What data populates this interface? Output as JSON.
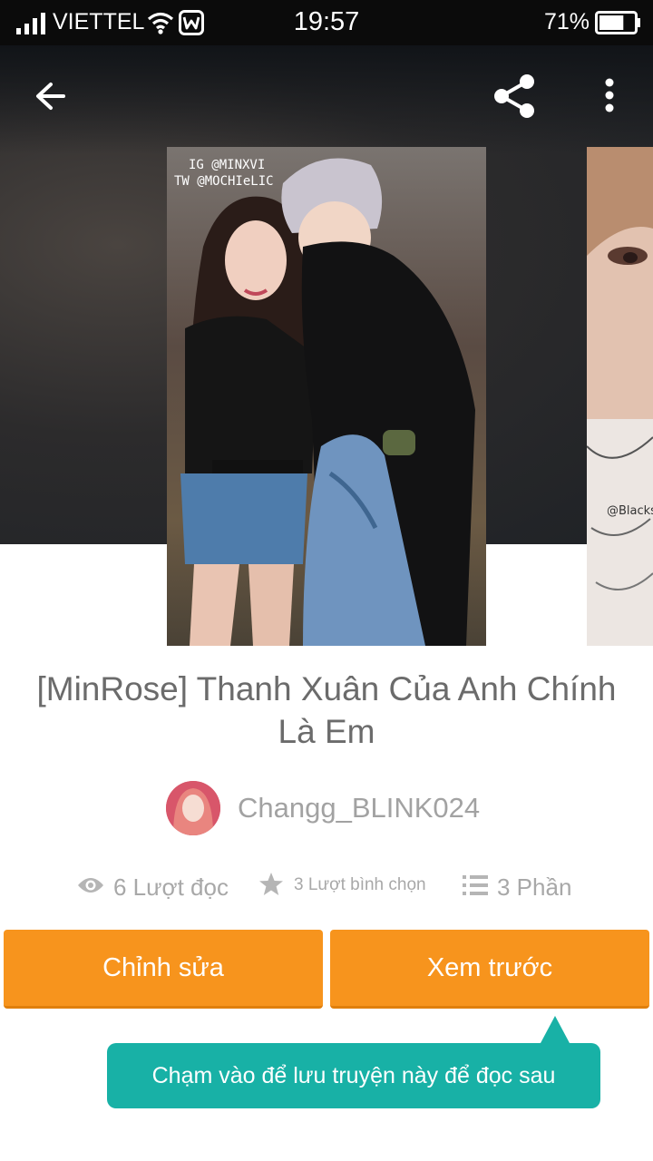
{
  "status_bar": {
    "carrier": "VIETTEL",
    "time": "19:57",
    "battery_percent": "71%",
    "battery_level": 0.71,
    "icons": [
      "signal-icon",
      "wifi-icon",
      "notification-w-icon",
      "battery-icon"
    ]
  },
  "toolbar": {
    "icons": [
      "back-arrow-icon",
      "share-icon",
      "more-vertical-icon"
    ]
  },
  "story": {
    "title": "[MinRose] Thanh Xuân Của Anh Chính Là Em",
    "cover_text": [
      "IG @MINXVI",
      "TW @MOCHIeLIC"
    ],
    "next_cover_text": "@Blacks"
  },
  "author": {
    "name": "Changg_BLINK024"
  },
  "stats": {
    "reads": "6 Lượt đọc",
    "votes": "3 Lượt bình chọn",
    "parts": "3 Phần"
  },
  "actions": {
    "edit_label": "Chỉnh sửa",
    "preview_label": "Xem trước"
  },
  "tooltip": {
    "text": "Chạm vào để lưu truyện này để đọc sau"
  },
  "colors": {
    "accent_orange": "#f7941d",
    "tooltip_teal": "#18b1a6",
    "status_bar": "#0b0b0b",
    "text_gray": "#6b6b6b"
  }
}
